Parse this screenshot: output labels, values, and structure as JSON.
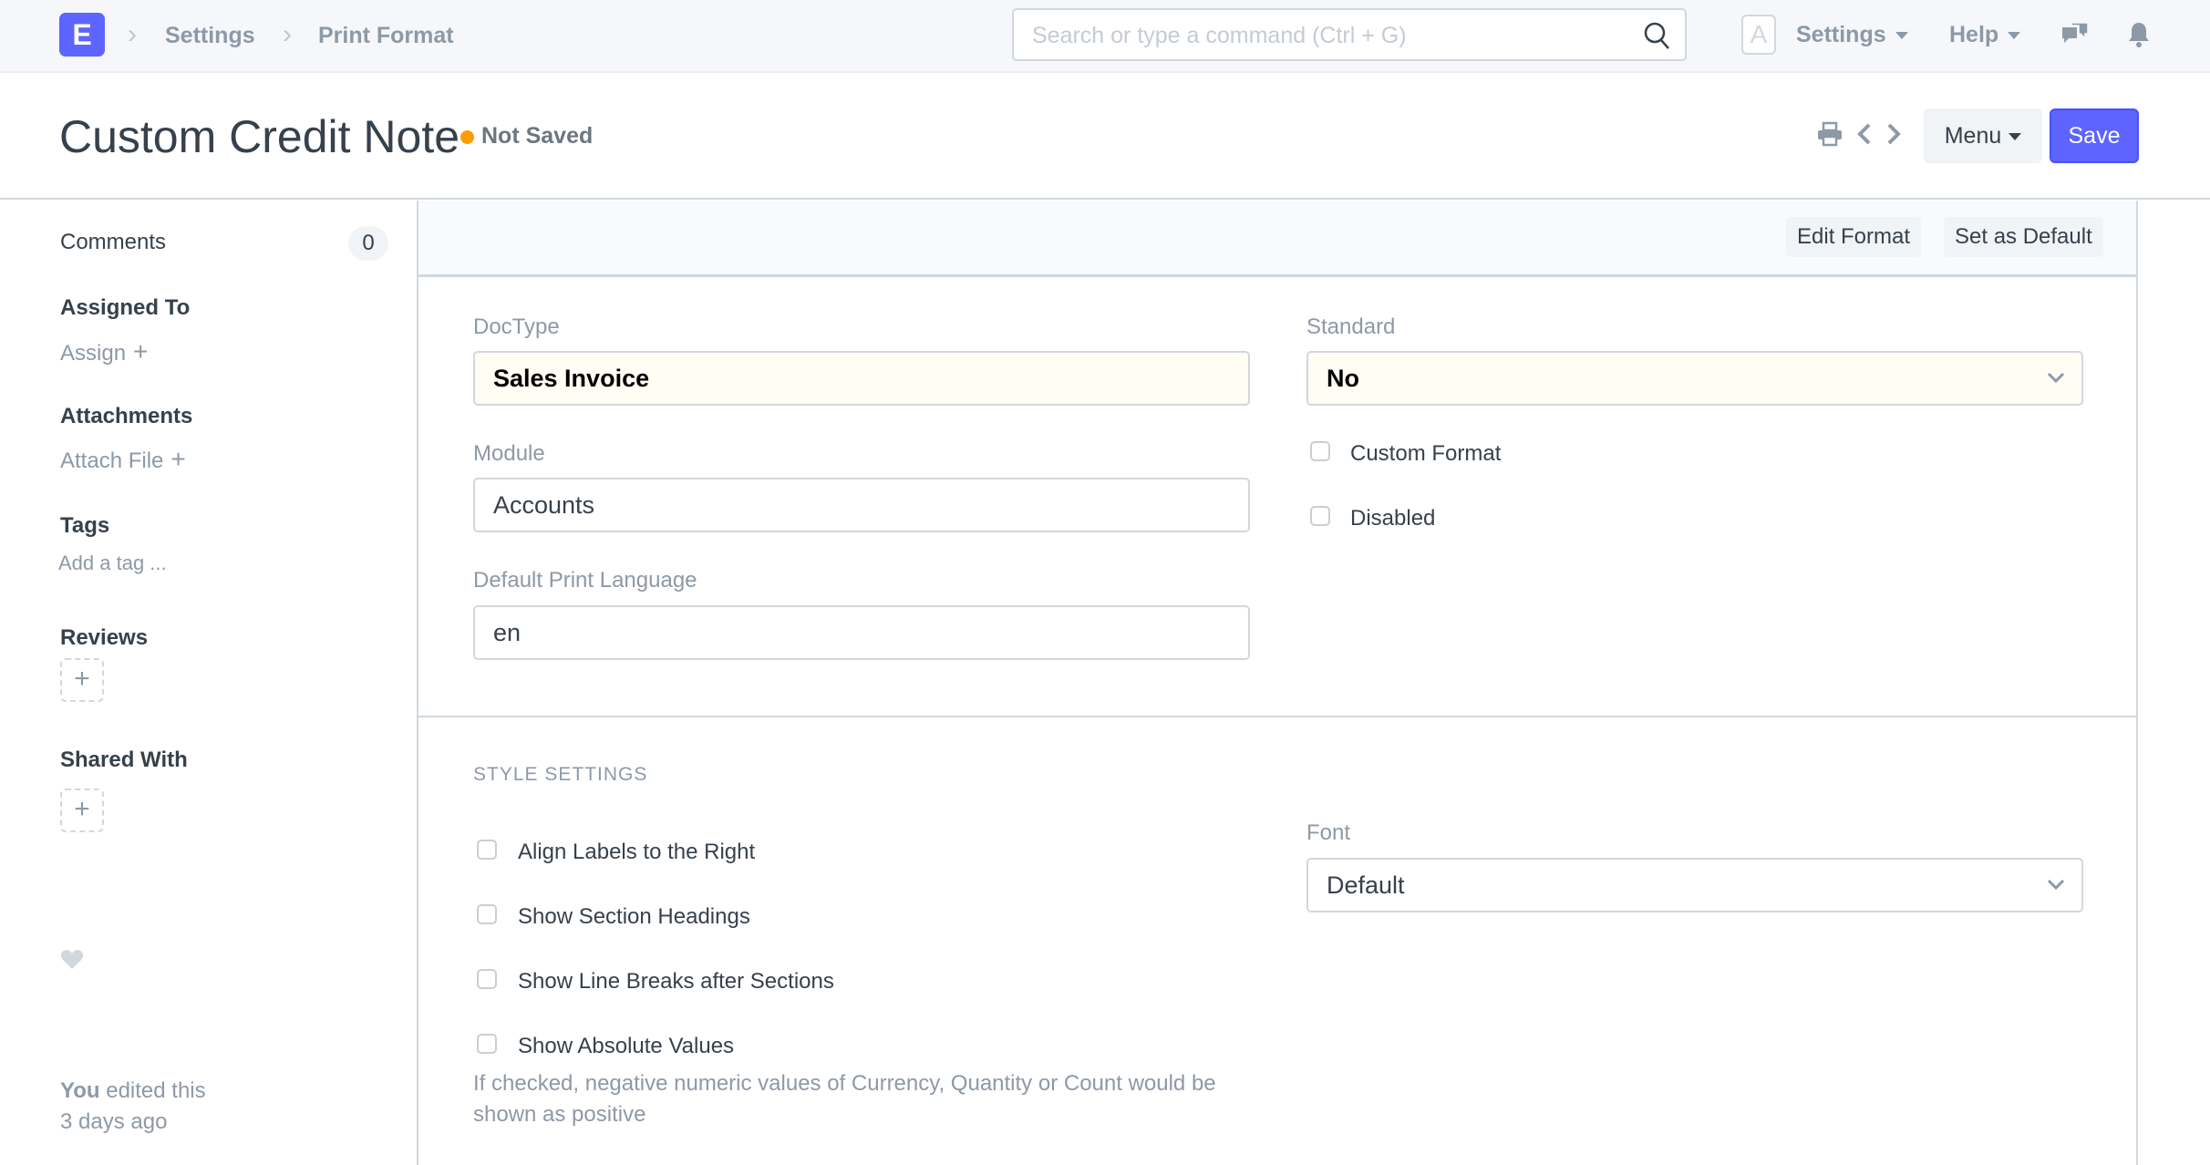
{
  "navbar": {
    "logo_letter": "E",
    "breadcrumbs": [
      "Settings",
      "Print Format"
    ],
    "search_placeholder": "Search or type a command (Ctrl + G)",
    "avatar_letter": "A",
    "settings_label": "Settings",
    "help_label": "Help",
    "brand_color": "#5e64ff"
  },
  "page": {
    "title": "Custom Credit Note",
    "status": "Not Saved",
    "status_color": "#ff9c00",
    "menu_label": "Menu",
    "save_label": "Save"
  },
  "sidebar": {
    "comments_label": "Comments",
    "comments_count": "0",
    "assigned_to_label": "Assigned To",
    "assign_link": "Assign",
    "attachments_label": "Attachments",
    "attach_link": "Attach File",
    "tags_label": "Tags",
    "add_tag": "Add a tag ...",
    "reviews_label": "Reviews",
    "shared_with_label": "Shared With",
    "edited_by": "You",
    "edited_text": "edited this",
    "edited_when": "3 days ago"
  },
  "toolbar": {
    "edit_format": "Edit Format",
    "set_default": "Set as Default"
  },
  "form": {
    "doctype_label": "DocType",
    "doctype_value": "Sales Invoice",
    "module_label": "Module",
    "module_value": "Accounts",
    "language_label": "Default Print Language",
    "language_value": "en",
    "standard_label": "Standard",
    "standard_value": "No",
    "custom_format_label": "Custom Format",
    "custom_format_checked": false,
    "disabled_label": "Disabled",
    "disabled_checked": false
  },
  "style_settings": {
    "title": "STYLE SETTINGS",
    "checkboxes": [
      {
        "label": "Align Labels to the Right",
        "checked": false
      },
      {
        "label": "Show Section Headings",
        "checked": false
      },
      {
        "label": "Show Line Breaks after Sections",
        "checked": false
      },
      {
        "label": "Show Absolute Values",
        "checked": false
      }
    ],
    "absolute_values_desc": "If checked, negative numeric values of Currency, Quantity or Count would be shown as positive",
    "font_label": "Font",
    "font_value": "Default"
  }
}
